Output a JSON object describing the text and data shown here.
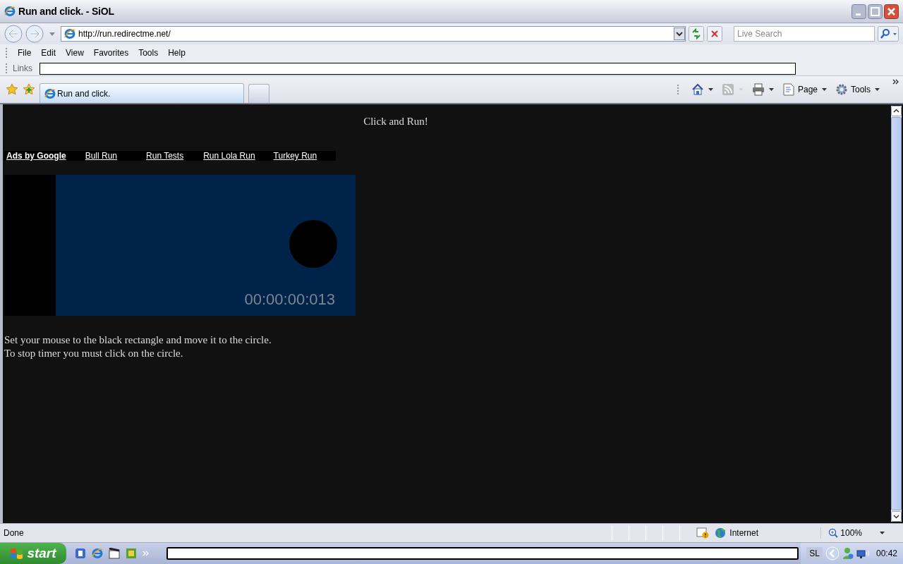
{
  "window": {
    "title": "Run and click. - SiOL"
  },
  "address_bar": {
    "url": "http://run.redirectme.net/"
  },
  "search": {
    "placeholder": "Live Search"
  },
  "menu": [
    "File",
    "Edit",
    "View",
    "Favorites",
    "Tools",
    "Help"
  ],
  "links_bar": {
    "label": "Links"
  },
  "tabs": [
    {
      "label": "Run and click.",
      "selected": true
    }
  ],
  "command_bar": [
    {
      "kind": "home",
      "disabled": false
    },
    {
      "kind": "feeds",
      "disabled": true
    },
    {
      "kind": "print",
      "disabled": false
    },
    {
      "kind": "page",
      "label": "Page",
      "disabled": false
    },
    {
      "kind": "tools",
      "label": "Tools",
      "disabled": false
    }
  ],
  "page": {
    "heading": "Click and Run!",
    "ads_label": "Ads by Google",
    "ad_links": [
      "Bull Run",
      "Run Tests",
      "Run Lola Run",
      "Turkey Run"
    ],
    "game": {
      "timer": "00:00:00:013"
    },
    "instructions": [
      "Set your mouse to the black rectangle and move it to the circle.",
      "To stop timer you must click on the circle."
    ]
  },
  "status_bar": {
    "text": "Done",
    "zone": "Internet",
    "zoom": "100%"
  },
  "taskbar": {
    "start": "start",
    "language": "SL",
    "clock": "00:42"
  }
}
